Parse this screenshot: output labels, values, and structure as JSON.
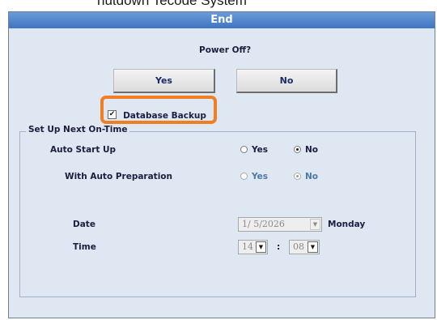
{
  "background_title": "nutdown Tecode System",
  "dialog": {
    "title": "End",
    "question": "Power Off?",
    "yes_label": "Yes",
    "no_label": "No",
    "db_backup": {
      "label": "Database Backup",
      "checked": true,
      "check_glyph": "✔"
    }
  },
  "next_on_time": {
    "legend": "Set Up Next On-Time",
    "auto_start": {
      "label": "Auto Start Up",
      "yes": "Yes",
      "no": "No",
      "selected": "No"
    },
    "auto_prep": {
      "label": "With Auto Preparation",
      "yes": "Yes",
      "no": "No",
      "selected": "No",
      "disabled": true
    },
    "date": {
      "label": "Date",
      "value": "1/ 5/2026",
      "weekday": "Monday"
    },
    "time": {
      "label": "Time",
      "hour": "14",
      "separator": ":",
      "minute": "08"
    }
  },
  "colors": {
    "highlight": "#f07e22",
    "titlebar": "#4a80c8",
    "dialog_bg": "#dfe7f3"
  },
  "icons": {
    "dropdown_arrow": "▼"
  }
}
